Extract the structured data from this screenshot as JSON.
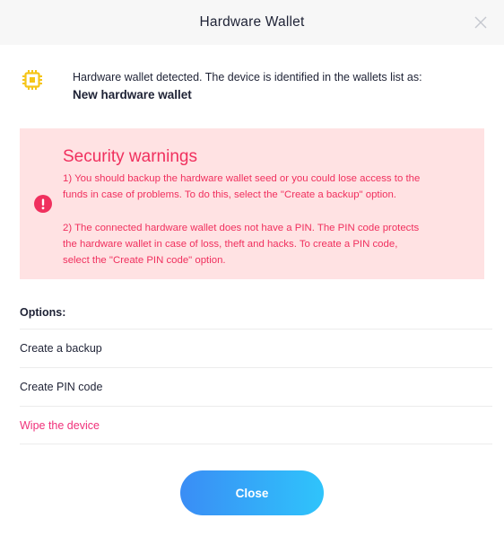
{
  "header": {
    "title": "Hardware Wallet",
    "close_icon": "close-icon"
  },
  "detection": {
    "icon": "chip-icon",
    "icon_color": "#f5c518",
    "text": "Hardware wallet detected. The device is identified in the wallets list as:",
    "wallet_name": "New hardware wallet"
  },
  "warnings": {
    "icon": "alert-circle-icon",
    "background_color": "#ffe2e3",
    "accent_color": "#f0305e",
    "title": "Security warnings",
    "line_1a": "1) You should backup the hardware wallet seed or you could lose access to the",
    "line_1b": "funds in case of problems. To do this, select the \"Create a backup\" option.",
    "line_2a": "2) The connected hardware wallet does not have a PIN. The PIN code protects",
    "line_2b": "the hardware wallet in case of loss, theft and hacks. To create a PIN code,",
    "line_2c": "select the \"Create PIN code\" option."
  },
  "options": {
    "label": "Options:",
    "items": [
      {
        "label": "Create a backup"
      },
      {
        "label": "Create PIN code"
      },
      {
        "label": "Wipe the device",
        "color": "#f0307a"
      }
    ]
  },
  "footer": {
    "close_label": "Close",
    "gradient_start": "#3a8df5",
    "gradient_end": "#2fc4fb"
  }
}
